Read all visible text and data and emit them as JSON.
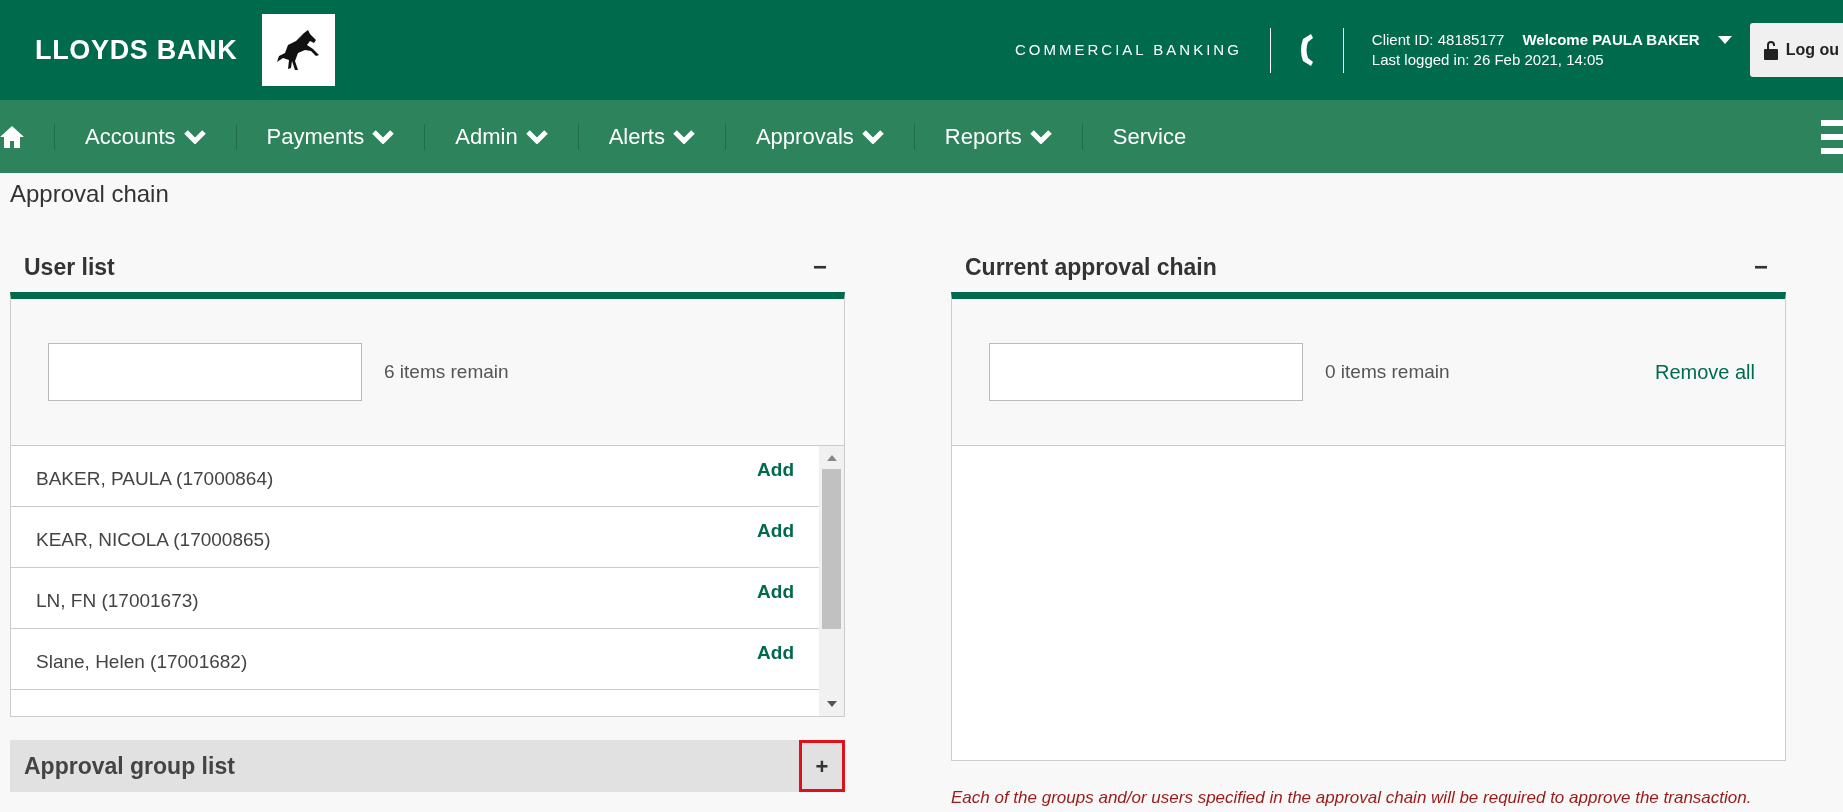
{
  "header": {
    "brand": "LLOYDS BANK",
    "division": "COMMERCIAL BANKING",
    "client_id": "Client ID: 48185177",
    "welcome": "Welcome PAULA BAKER",
    "last_logged": "Last logged in: 26 Feb 2021, 14:05",
    "logout": "Log ou"
  },
  "nav": [
    {
      "label": "Accounts",
      "dropdown": true
    },
    {
      "label": "Payments",
      "dropdown": true
    },
    {
      "label": "Admin",
      "dropdown": true
    },
    {
      "label": "Alerts",
      "dropdown": true
    },
    {
      "label": "Approvals",
      "dropdown": true
    },
    {
      "label": "Reports",
      "dropdown": true
    },
    {
      "label": "Service",
      "dropdown": false
    }
  ],
  "page_title": "Approval chain",
  "user_list": {
    "title": "User list",
    "toggle": "−",
    "remaining": "6 items remain",
    "rows": [
      {
        "name": "BAKER, PAULA (17000864)",
        "action": "Add"
      },
      {
        "name": "KEAR, NICOLA (17000865)",
        "action": "Add"
      },
      {
        "name": "LN, FN (17001673)",
        "action": "Add"
      },
      {
        "name": "Slane, Helen (17001682)",
        "action": "Add"
      }
    ]
  },
  "group_list": {
    "title": "Approval group list",
    "toggle": "+",
    "expanded": false
  },
  "chain": {
    "title": "Current approval chain",
    "toggle": "−",
    "remaining": "0 items remain",
    "remove_all": "Remove all",
    "note": "Each of the groups and/or users specified in the approval chain will be required to approve the transaction."
  }
}
